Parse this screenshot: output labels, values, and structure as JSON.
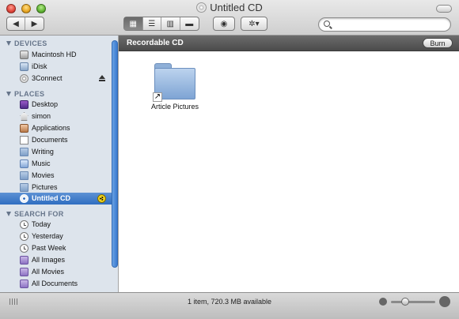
{
  "window": {
    "title": "Untitled CD"
  },
  "toolbar": {
    "search_placeholder": "",
    "view_modes": [
      "icon",
      "list",
      "column",
      "coverflow"
    ],
    "active_view": "icon"
  },
  "sidebar": {
    "groups": [
      {
        "label": "DEVICES",
        "items": [
          {
            "label": "Macintosh HD",
            "icon": "hard-drive-icon"
          },
          {
            "label": "iDisk",
            "icon": "idisk-icon"
          },
          {
            "label": "3Connect",
            "icon": "disc-icon"
          }
        ]
      },
      {
        "label": "PLACES",
        "items": [
          {
            "label": "Desktop",
            "icon": "desktop-icon"
          },
          {
            "label": "simon",
            "icon": "home-icon"
          },
          {
            "label": "Applications",
            "icon": "applications-icon"
          },
          {
            "label": "Documents",
            "icon": "documents-icon"
          },
          {
            "label": "Writing",
            "icon": "folder-icon"
          },
          {
            "label": "Music",
            "icon": "music-icon"
          },
          {
            "label": "Movies",
            "icon": "movies-icon"
          },
          {
            "label": "Pictures",
            "icon": "pictures-icon"
          },
          {
            "label": "Untitled CD",
            "icon": "cd-icon",
            "selected": true
          }
        ]
      },
      {
        "label": "SEARCH FOR",
        "items": [
          {
            "label": "Today",
            "icon": "clock-icon"
          },
          {
            "label": "Yesterday",
            "icon": "clock-icon"
          },
          {
            "label": "Past Week",
            "icon": "clock-icon"
          },
          {
            "label": "All Images",
            "icon": "smart-folder-icon"
          },
          {
            "label": "All Movies",
            "icon": "smart-folder-icon"
          },
          {
            "label": "All Documents",
            "icon": "smart-folder-icon"
          }
        ]
      }
    ]
  },
  "main": {
    "path_title": "Recordable CD",
    "burn_label": "Burn",
    "files": [
      {
        "name": "Article Pictures",
        "type": "folder-alias"
      }
    ]
  },
  "status": {
    "text": "1 item, 720.3 MB available"
  },
  "colors": {
    "selection": "#3a7bd0",
    "sidebar_bg": "#dde4ec",
    "burn_badge": "#f2d31b"
  }
}
